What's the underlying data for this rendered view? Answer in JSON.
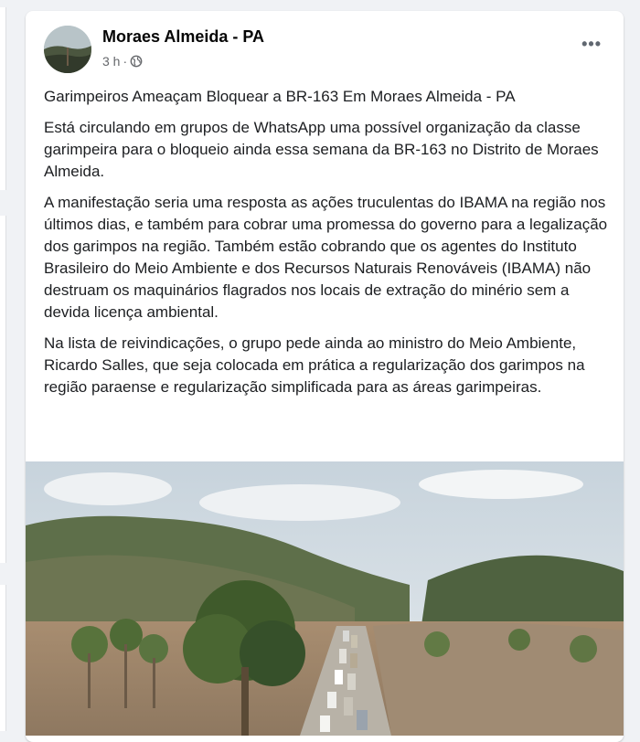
{
  "post": {
    "author": "Moraes Almeida - PA",
    "time": "3 h",
    "separator": "·",
    "more_label": "•••",
    "paragraphs": [
      "Garimpeiros Ameaçam Bloquear a BR-163 Em Moraes Almeida - PA",
      "Está circulando em grupos de WhatsApp uma possível organização da classe garimpeira para o bloqueio ainda essa semana da BR-163 no Distrito de Moraes Almeida.",
      "A manifestação seria uma resposta as ações truculentas do IBAMA na região nos últimos dias, e também para cobrar uma promessa do governo para a legalização dos garimpos na região. Também estão cobrando que os agentes do Instituto Brasileiro do Meio Ambiente e dos Recursos Naturais Renováveis (IBAMA) não destruam os maquinários flagrados nos locais de extração do minério sem a devida licença ambiental.",
      "Na lista de reivindicações, o grupo pede ainda ao ministro do Meio Ambiente, Ricardo Salles, que seja colocada em prática a regularização dos garimpos na região paraense e regularização simplificada para as áreas garimpeiras."
    ]
  },
  "icons": {
    "privacy": "globe-icon",
    "more": "more-options-icon"
  },
  "colors": {
    "background": "#f0f2f5",
    "card": "#ffffff",
    "text": "#1c1e21",
    "meta": "#65676b"
  }
}
